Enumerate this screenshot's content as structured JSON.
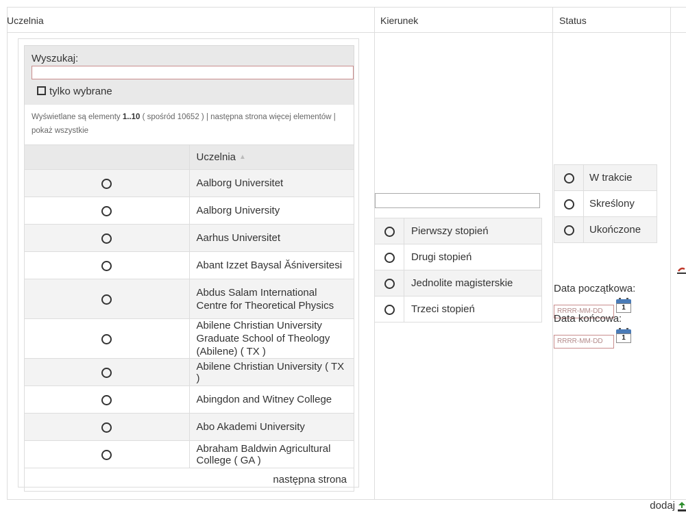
{
  "headers": {
    "uczelnia": "Uczelnia",
    "kierunek": "Kierunek",
    "status": "Status"
  },
  "picker": {
    "search_label": "Wyszukaj:",
    "search_value": "",
    "only_selected_label": "tylko wybrane",
    "info_prefix": "Wyświetlane są elementy ",
    "info_range": "1..10",
    "info_middle": " ( spośród 10652 ) | następna strona więcej elementów | pokaż wszystkie",
    "column_header": "Uczelnia",
    "rows": [
      "Aalborg Universitet",
      "Aalborg University",
      "Aarhus Universitet",
      "Abant Izzet Baysal Ăśniversitesi",
      "Abdus Salam International Centre for Theoretical Physics",
      "Abilene Christian University Graduate School of Theology (Abilene) ( TX )",
      "Abilene Christian University ( TX )",
      "Abingdon and Witney College",
      "Abo Akademi University",
      "Abraham Baldwin Agricultural College ( GA )"
    ],
    "next_page": "następna strona"
  },
  "kierunek": {
    "input_value": "",
    "degrees": [
      "Pierwszy stopień",
      "Drugi stopień",
      "Jednolite magisterskie",
      "Trzeci stopień"
    ]
  },
  "status": {
    "options": [
      "W trakcie",
      "Skreślony",
      "Ukończone"
    ],
    "start_label": "Data początkowa:",
    "end_label": "Data końcowa:",
    "date_placeholder": "RRRR-MM-DD",
    "calendar_day": "1"
  },
  "add_label": "dodaj",
  "colors": {
    "border": "#dddddd",
    "header_bg": "#e9e9e9",
    "stripe": "#f3f3f3",
    "input_border": "#c98c8c",
    "add_icon": "#2f8f2f"
  }
}
